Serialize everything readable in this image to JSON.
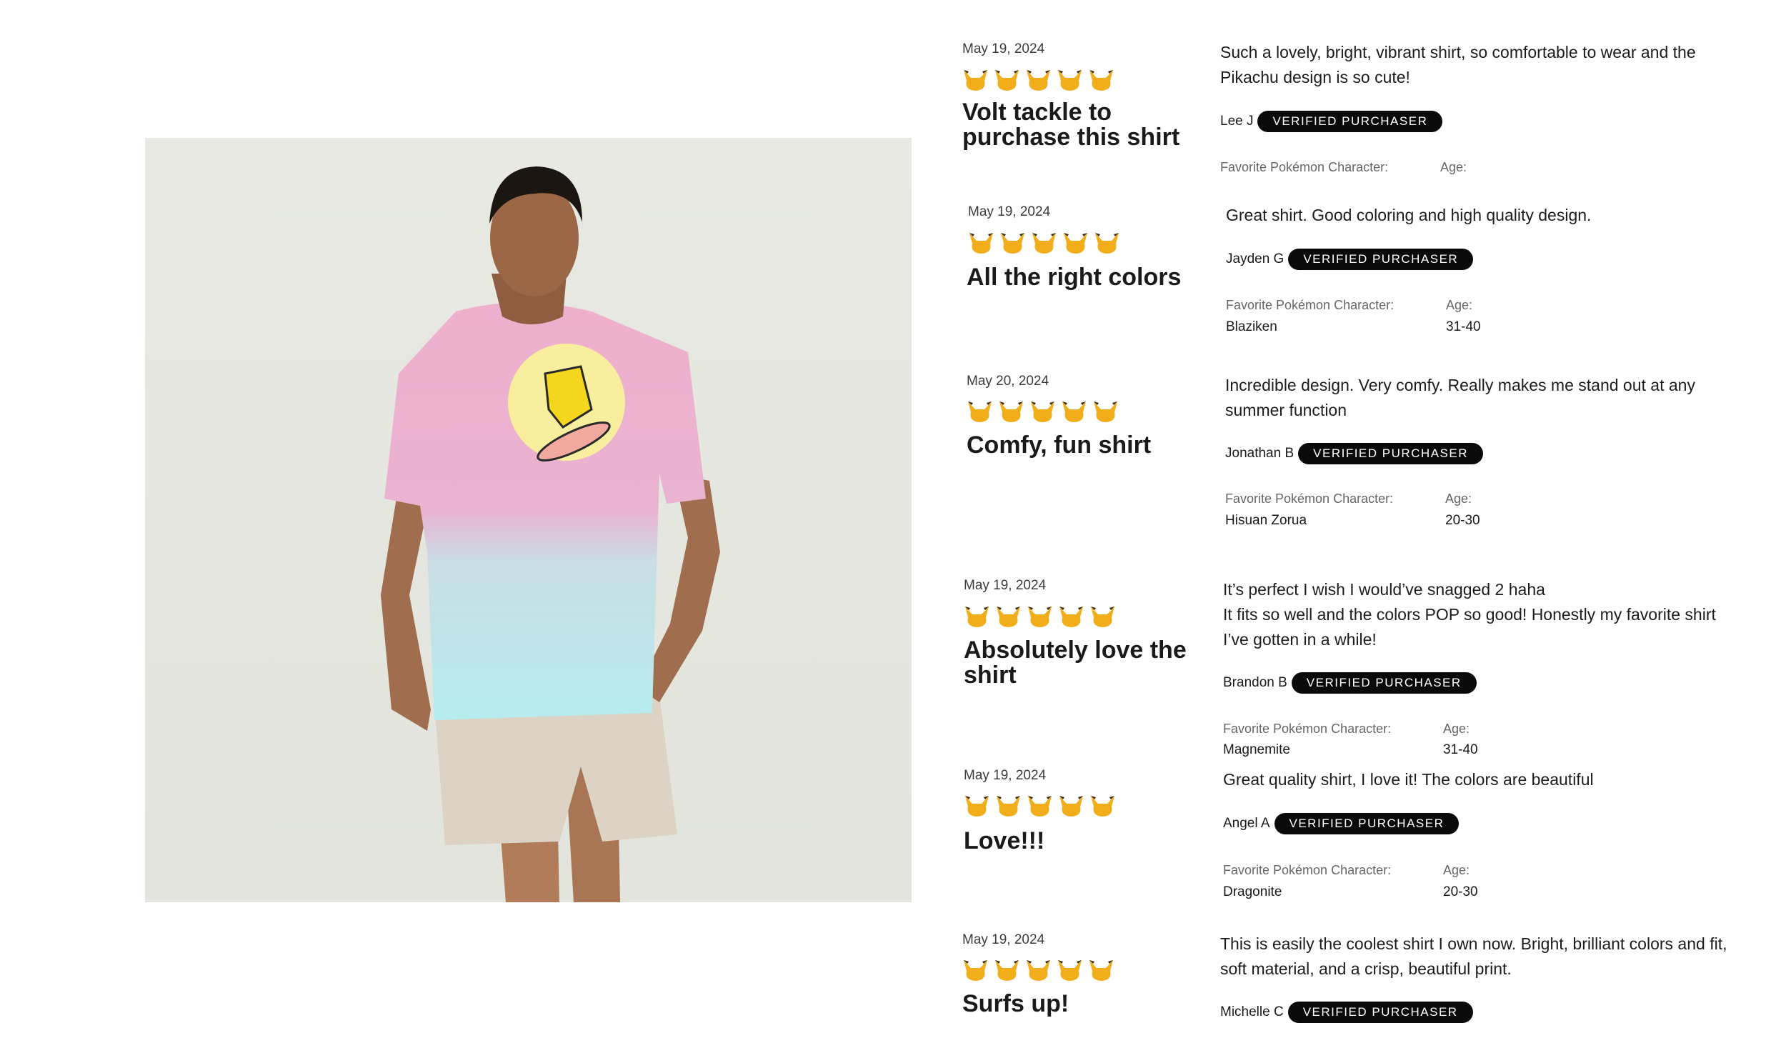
{
  "colors": {
    "star": "#f2ad1a",
    "badge": "#0a0a0a",
    "badge_text": "#ffffff",
    "photo_background": "#e4e6df"
  },
  "icons": {
    "rating": "pikachu-head-icon"
  },
  "image": {
    "name": "model-wearing-pikachu-surf-tie-dye-shirt"
  },
  "labels": {
    "favorite": "Favorite Pokémon Character:",
    "age": "Age:"
  },
  "reviews": [
    {
      "date": "May 19, 2024",
      "rating": 5,
      "title": "Volt tackle to purchase this shirt",
      "body": "Such a lovely, bright, vibrant shirt, so comfortable to wear and the Pikachu design is so cute!",
      "reviewer": "Lee J",
      "badge": "VERIFIED PURCHASER",
      "favorite": "",
      "age": ""
    },
    {
      "date": "May 19, 2024",
      "rating": 5,
      "title": "All the right colors",
      "body": "Great shirt. Good coloring and high quality design.",
      "reviewer": "Jayden G",
      "badge": "VERIFIED PURCHASER",
      "favorite": "Blaziken",
      "age": "31-40"
    },
    {
      "date": "May 20, 2024",
      "rating": 5,
      "title": "Comfy, fun shirt",
      "body": "Incredible design. Very comfy. Really makes me stand out at any summer function",
      "reviewer": "Jonathan B",
      "badge": "VERIFIED PURCHASER",
      "favorite": "Hisuan Zorua",
      "age": "20-30"
    },
    {
      "date": "May 19, 2024",
      "rating": 5,
      "title": "Absolutely love the shirt",
      "body": "It’s perfect I wish I would’ve snagged 2 haha\nIt fits so well and the colors POP so good! Honestly my favorite shirt I’ve gotten in a while!",
      "reviewer": "Brandon B",
      "badge": "VERIFIED PURCHASER",
      "favorite": "Magnemite",
      "age": "31-40"
    },
    {
      "date": "May 19, 2024",
      "rating": 5,
      "title": "Love!!!",
      "body": "Great quality shirt, I love it! The colors are beautiful",
      "reviewer": "Angel A",
      "badge": "VERIFIED PURCHASER",
      "favorite": "Dragonite",
      "age": "20-30"
    },
    {
      "date": "May 19, 2024",
      "rating": 5,
      "title": "Surfs up!",
      "body": "This is easily the coolest shirt I own now. Bright, brilliant colors and fit, soft material, and a crisp, beautiful print.",
      "reviewer": "Michelle C",
      "badge": "VERIFIED PURCHASER",
      "favorite": "",
      "age": ""
    }
  ]
}
